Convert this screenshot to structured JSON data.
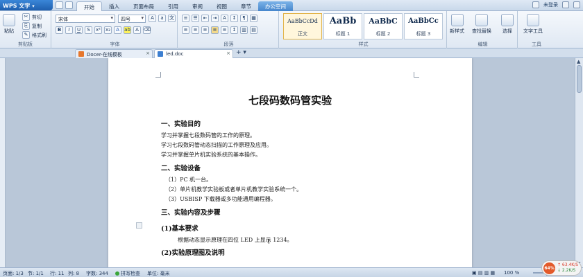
{
  "menubar": {
    "app_label": "WPS 文字",
    "tabs": [
      "开始",
      "插入",
      "页面布局",
      "引用",
      "审阅",
      "视图",
      "章节",
      "办公空间"
    ],
    "active_tab": "开始",
    "login": "未登录"
  },
  "ribbon": {
    "paste": "粘贴",
    "cut": "剪切",
    "copy": "复制",
    "format_painter": "格式刷",
    "clipboard_group": "剪贴板",
    "font_name": "宋体",
    "font_size": "四号",
    "font_group": "字体",
    "paragraph_group": "段落",
    "styles": [
      {
        "preview": "AaBbCcDd",
        "name": "正文"
      },
      {
        "preview": "AaBb",
        "name": "标题 1"
      },
      {
        "preview": "AaBbC",
        "name": "标题 2"
      },
      {
        "preview": "AaBbCc",
        "name": "标题 3"
      }
    ],
    "styles_group": "样式",
    "new_style": "新样式",
    "find_replace": "查找替换",
    "select": "选择",
    "edit_group": "编辑",
    "text_tools": "文字工具",
    "tools_group": "工具"
  },
  "doc_tabs": [
    {
      "label": "Docer-在线模板"
    },
    {
      "label": "led.doc"
    }
  ],
  "document": {
    "title": "七段码数码管实验",
    "h1": "一、实验目的",
    "p1": "学习并掌握七段数码管的工作的原理。",
    "p2": "学习七段数码管动态扫描的工作原理及应用。",
    "p3": "学习并掌握单片机实验系统的基本操作。",
    "h2": "二、实验设备",
    "p4": "（1）PC 机一台。",
    "p5": "（2）单片机教学实验板或者单片机教学实验系统一个。",
    "p6": "（3）USBISP 下载器或多功能通用编程器。",
    "h3": "三、实验内容及步骤",
    "h4": "(1)基本要求",
    "p7": "根据动态显示原理在四位 LED 上显示 1234。",
    "h5": "(2)实验原理图及说明"
  },
  "status": {
    "page": "页面: 1/3",
    "section": "节: 1/1",
    "row": "行: 11",
    "col": "列: 8",
    "words": "字数: 344",
    "spell": "拼写检查",
    "unit": "单位: 毫米",
    "zoom": "100 %",
    "zoom_level": 0.5
  },
  "speed": {
    "percent": "64%",
    "up": "↑ 63.4K/S",
    "down": "↓ 2.2K/S"
  }
}
